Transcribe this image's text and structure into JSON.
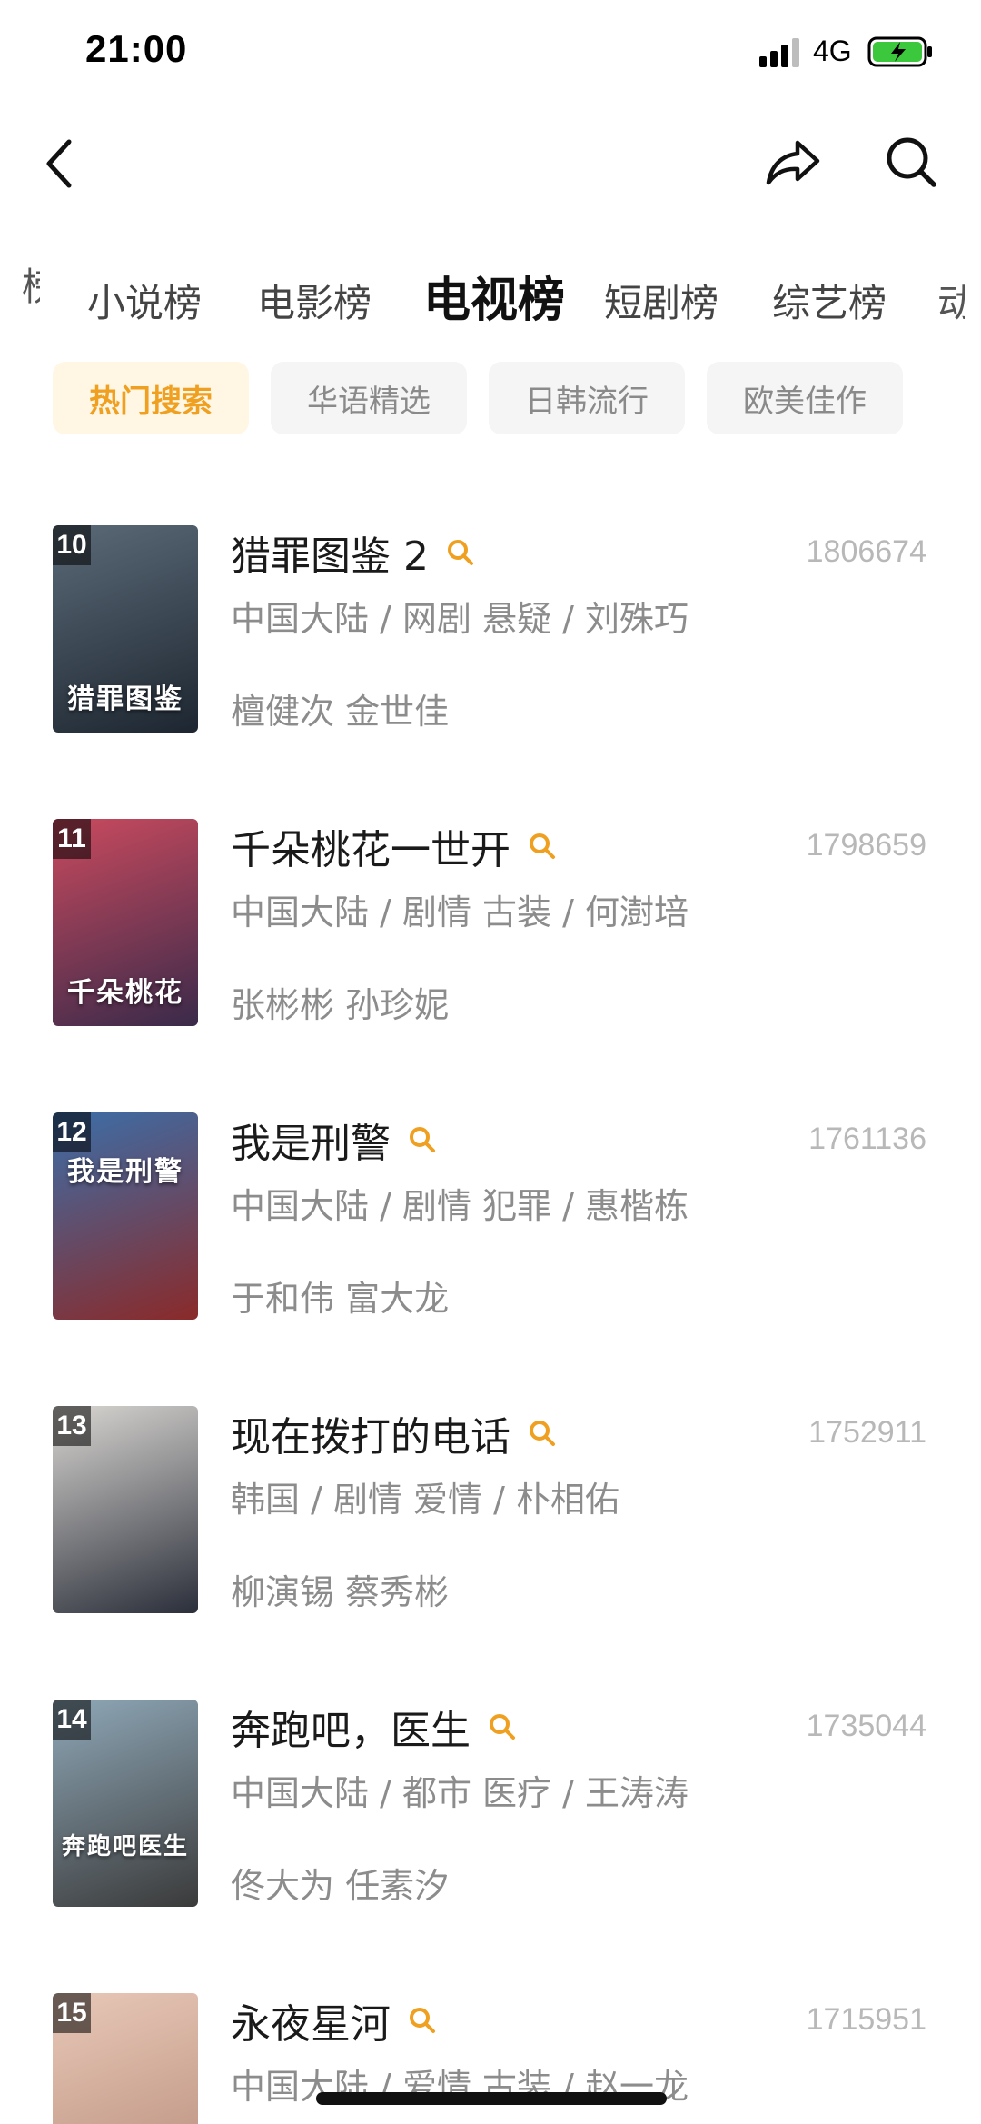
{
  "status_bar": {
    "time": "21:00",
    "network": "4G"
  },
  "tabs": {
    "edge_left": "榜",
    "items": [
      "小说榜",
      "电影榜",
      "电视榜",
      "短剧榜",
      "综艺榜"
    ],
    "edge_right": "动",
    "active": "电视榜"
  },
  "chips": {
    "items": [
      "热门搜索",
      "华语精选",
      "日韩流行",
      "欧美佳作"
    ],
    "active": "热门搜索"
  },
  "list": [
    {
      "rank": "10",
      "title": "猎罪图鉴 2",
      "heat": "1806674",
      "meta": "中国大陆 / 网剧 悬疑 / 刘殊巧",
      "cast": "檀健次 金世佳",
      "poster_text": "猎罪图鉴",
      "poster_colors": [
        "#5b6a78",
        "#1d2630"
      ]
    },
    {
      "rank": "11",
      "title": "千朵桃花一世开",
      "heat": "1798659",
      "meta": "中国大陆 / 剧情 古装 / 何澍培",
      "cast": "张彬彬 孙珍妮",
      "poster_text": "千朵桃花",
      "poster_colors": [
        "#c94a5e",
        "#3a2a4a"
      ]
    },
    {
      "rank": "12",
      "title": "我是刑警",
      "heat": "1761136",
      "meta": "中国大陆 / 剧情 犯罪 / 惠楷栋",
      "cast": "于和伟 富大龙",
      "poster_text": "我是刑警",
      "poster_colors": [
        "#3c6ea8",
        "#8a2a2a"
      ]
    },
    {
      "rank": "13",
      "title": "现在拨打的电话",
      "heat": "1752911",
      "meta": "韩国 / 剧情 爱情 / 朴相佑",
      "cast": "柳演锡 蔡秀彬",
      "poster_text": "",
      "poster_colors": [
        "#d9d6d2",
        "#2b2f3a"
      ]
    },
    {
      "rank": "14",
      "title": "奔跑吧，医生",
      "heat": "1735044",
      "meta": "中国大陆 / 都市 医疗 / 王涛涛",
      "cast": "佟大为 任素汐",
      "poster_text": "奔跑吧医生",
      "poster_colors": [
        "#8fa8b8",
        "#3a3a3a"
      ]
    },
    {
      "rank": "15",
      "title": "永夜星河",
      "heat": "1715951",
      "meta": "中国大陆 / 爱情 古装 / 赵一龙",
      "cast": "",
      "poster_text": "",
      "poster_colors": [
        "#e8c8b8",
        "#b88c7a"
      ]
    }
  ],
  "colors": {
    "accent": "#f0a020",
    "accent_bg": "#fff6e4",
    "battery_green": "#3cc83c"
  },
  "icons": {
    "back": "chevron-left-icon",
    "share": "share-arrow-icon",
    "search": "search-icon"
  }
}
